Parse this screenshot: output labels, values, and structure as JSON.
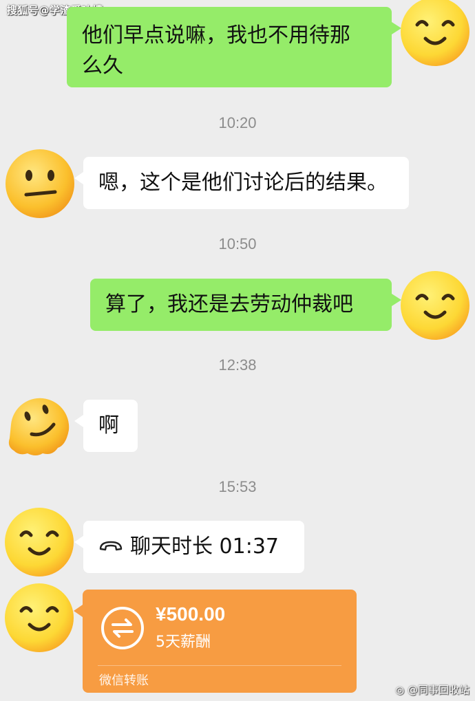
{
  "watermarks": {
    "top": "搜狐号@学渣爱吐槽",
    "bottom": "@同事回收站"
  },
  "messages": [
    {
      "type": "text",
      "side": "right",
      "text_line1": "他们早点说嘛，我也不用待那",
      "text_line2": "么久",
      "avatar": "smile-emoji"
    },
    {
      "type": "time",
      "text": "10:20"
    },
    {
      "type": "text",
      "side": "left",
      "text": "嗯，这个是他们讨论后的结果。",
      "avatar": "neutral-face-emoji"
    },
    {
      "type": "time",
      "text": "10:50"
    },
    {
      "type": "text",
      "side": "right",
      "text": "算了，我还是去劳动仲裁吧",
      "avatar": "smile-emoji"
    },
    {
      "type": "time",
      "text": "12:38"
    },
    {
      "type": "text",
      "side": "left",
      "text": "啊",
      "avatar": "melting-face-emoji"
    },
    {
      "type": "time",
      "text": "15:53"
    },
    {
      "type": "call",
      "side": "left",
      "text": "聊天时长 01:37",
      "icon": "phone-hangup-icon",
      "avatar": "smile-emoji"
    },
    {
      "type": "transfer",
      "side": "left",
      "amount": "¥500.00",
      "note": "5天薪酬",
      "footer": "微信转账",
      "icon": "transfer-arrows-icon",
      "avatar": "smile-emoji",
      "color": "#f79c42"
    }
  ],
  "colors": {
    "background": "#ededed",
    "sent_bubble": "#95ec69",
    "received_bubble": "#ffffff",
    "transfer_card": "#f79c42"
  }
}
